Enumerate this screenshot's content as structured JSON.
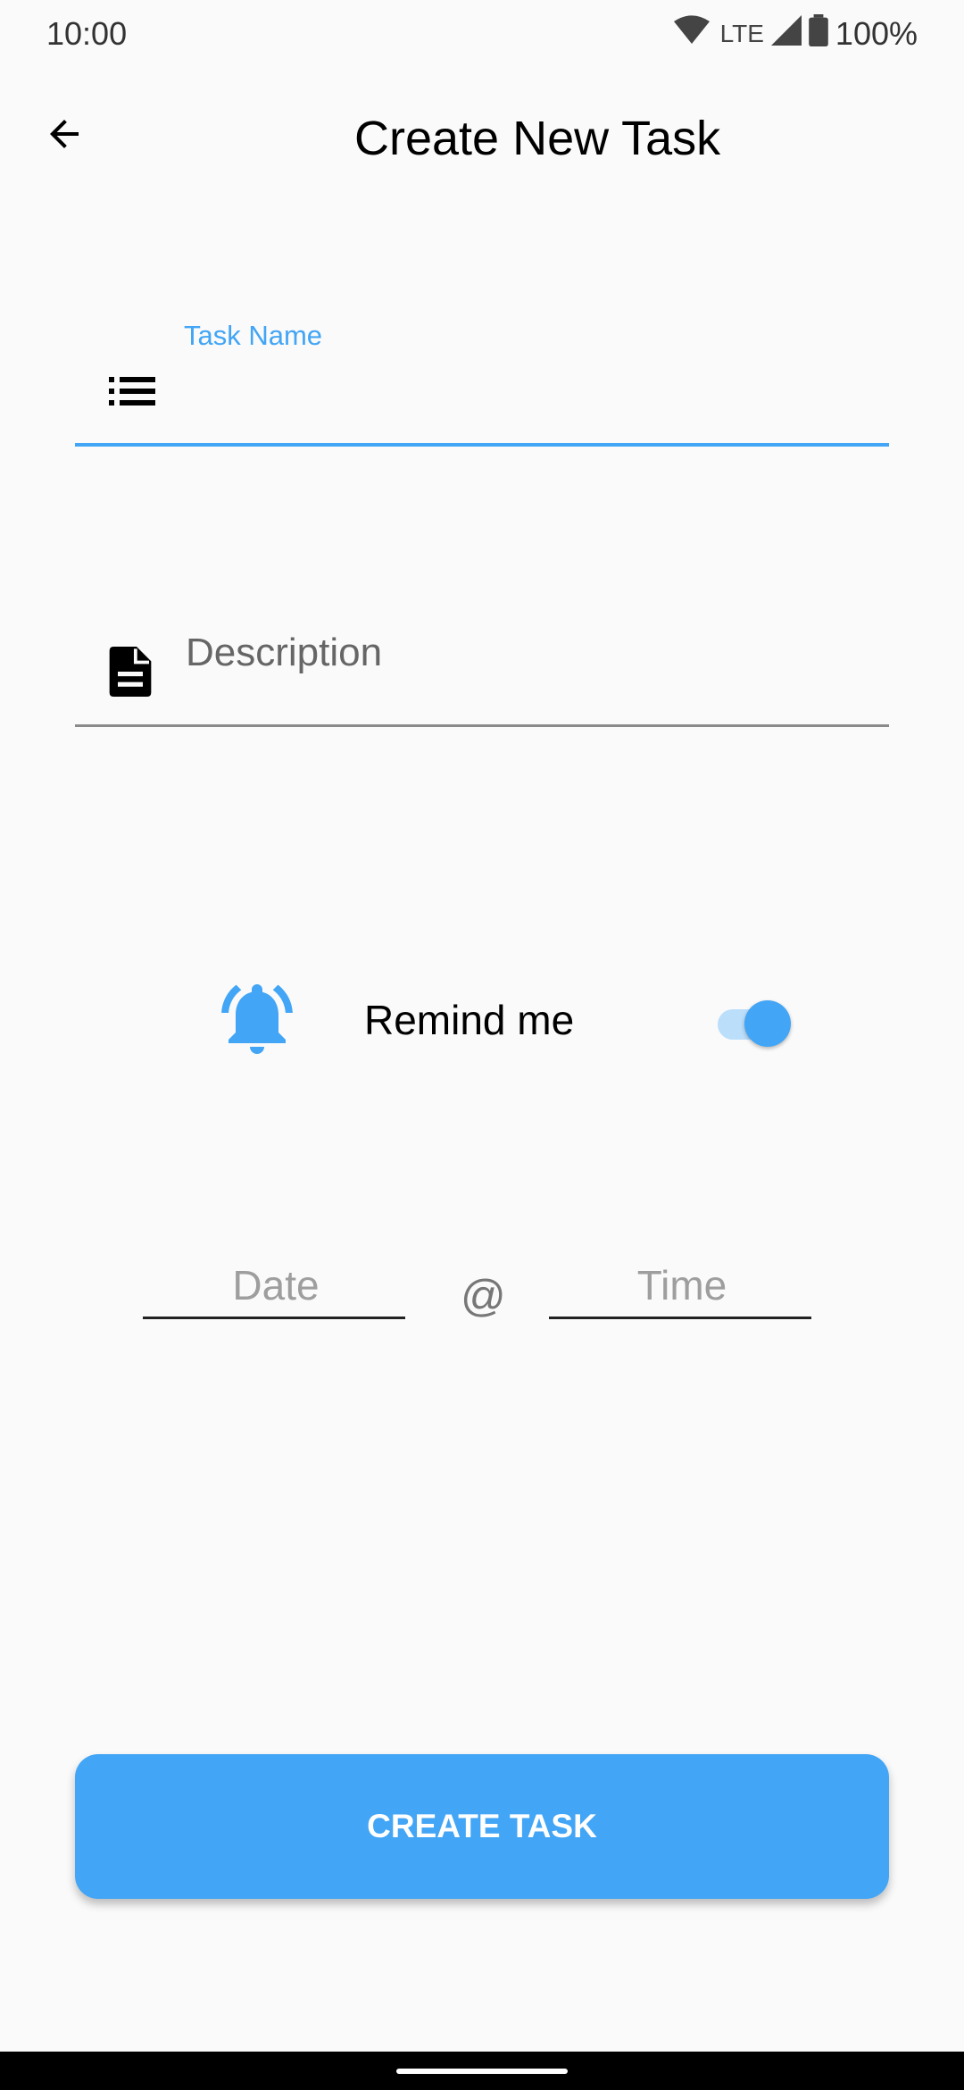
{
  "status_bar": {
    "time": "10:00",
    "network": "LTE",
    "battery": "100%"
  },
  "app_bar": {
    "title": "Create New Task"
  },
  "form": {
    "task_name": {
      "label": "Task Name",
      "value": "",
      "icon": "list-icon"
    },
    "description": {
      "placeholder": "Description",
      "value": "",
      "icon": "document-icon"
    },
    "reminder": {
      "label": "Remind me",
      "enabled": true,
      "icon": "bell-ringing-icon"
    },
    "date": {
      "placeholder": "Date",
      "value": ""
    },
    "separator": "@",
    "time": {
      "placeholder": "Time",
      "value": ""
    }
  },
  "actions": {
    "create_label": "CREATE TASK"
  },
  "colors": {
    "accent": "#42A5F5",
    "switch_track": "#BBDEFB",
    "background": "#FAFAFA"
  }
}
